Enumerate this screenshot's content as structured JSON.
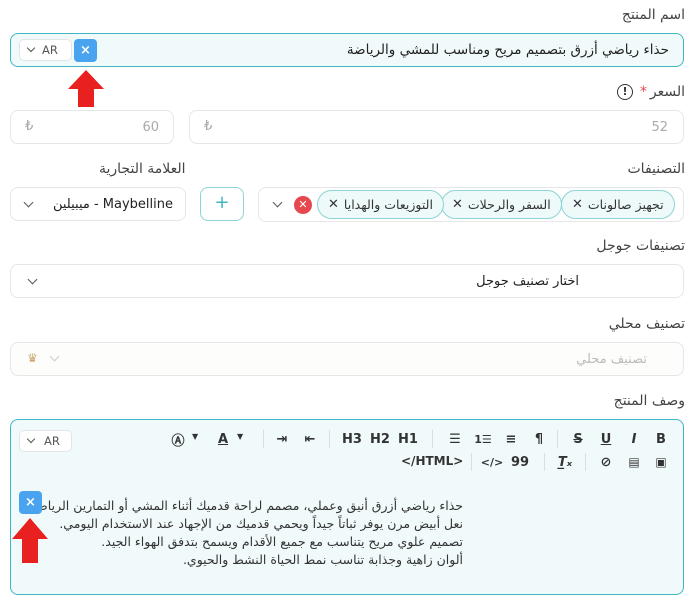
{
  "product_name": {
    "label": "اسم المنتج",
    "value": "حذاء رياضي أزرق بتصميم مريح ومناسب للمشي والرياضة",
    "lang": "AR"
  },
  "price": {
    "label": "السعر",
    "required_mark": "*",
    "price_value": "52",
    "compare_value": "60",
    "currency": "₺"
  },
  "categories": {
    "label": "التصنيفات",
    "chips": [
      "تجهيز صالونات",
      "السفر والرحلات",
      "التوزيعات والهدايا"
    ]
  },
  "brand": {
    "label": "العلامة التجارية",
    "value": "ميبيلين - Maybelline",
    "add": "+"
  },
  "google_category": {
    "label": "تصنيفات جوجل",
    "placeholder": "اختار تصنيف جوجل"
  },
  "local_category": {
    "label": "تصنيف محلي",
    "placeholder": "تصنيف محلي"
  },
  "description": {
    "label": "وصف المنتج",
    "lang": "AR",
    "html_label": "</HTML>",
    "lines": [
      "حذاء رياضي أزرق أنيق وعملي، مصمم لراحة قدميك أثناء المشي أو التمارين الرياضية.",
      "نعل أبيض مرن يوفر ثباتاً جيداً ويحمي قدميك من الإجهاد عند الاستخدام اليومي.",
      "تصميم علوي مريح يتناسب مع جميع الأقدام ويسمح بتدفق الهواء الجيد.",
      "ألوان زاهية وجذابة تناسب نمط الحياة النشط والحيوي."
    ]
  },
  "toolbar": {
    "h3": "H3",
    "h2": "H2",
    "h1": "H1",
    "bold": "B",
    "italic": "I",
    "underline": "U",
    "strike": "S",
    "quote": "99",
    "code": "</>",
    "text_color": "A"
  },
  "clear_button": "×",
  "colors": {
    "accent": "#3fb6c2",
    "xbutton": "#4aa3ee",
    "arrow": "#e8201f",
    "danger": "#e5484d"
  }
}
